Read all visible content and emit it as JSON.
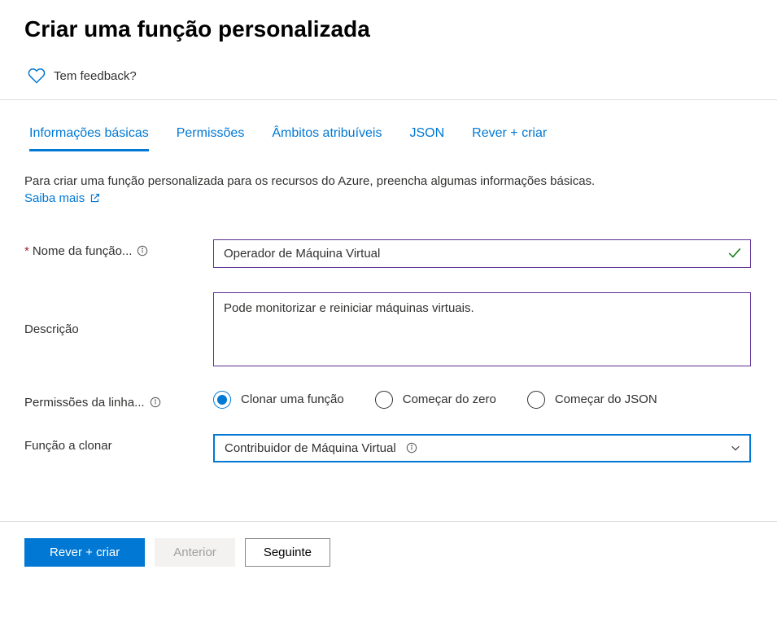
{
  "page": {
    "title": "Criar uma função personalizada"
  },
  "feedback": {
    "text": "Tem feedback?"
  },
  "tabs": [
    {
      "label": "Informações básicas",
      "active": true
    },
    {
      "label": "Permissões",
      "active": false
    },
    {
      "label": "Âmbitos atribuíveis",
      "active": false
    },
    {
      "label": "JSON",
      "active": false
    },
    {
      "label": "Rever + criar",
      "active": false
    }
  ],
  "intro": {
    "text": "Para criar uma função personalizada para os recursos do Azure, preencha algumas informações básicas.",
    "learn_more": "Saiba mais"
  },
  "form": {
    "role_name_label": "Nome da função...",
    "role_name_value": "Operador de Máquina Virtual",
    "description_label": "Descrição",
    "description_value": "Pode monitorizar e reiniciar máquinas virtuais.",
    "baseline_label": "Permissões da linha...",
    "radio_options": [
      {
        "label": "Clonar uma função",
        "selected": true
      },
      {
        "label": "Começar do zero",
        "selected": false
      },
      {
        "label": "Começar do JSON",
        "selected": false
      }
    ],
    "clone_label": "Função a clonar",
    "clone_value": "Contribuidor de Máquina Virtual"
  },
  "footer": {
    "review_create": "Rever + criar",
    "previous": "Anterior",
    "next": "Seguinte"
  }
}
